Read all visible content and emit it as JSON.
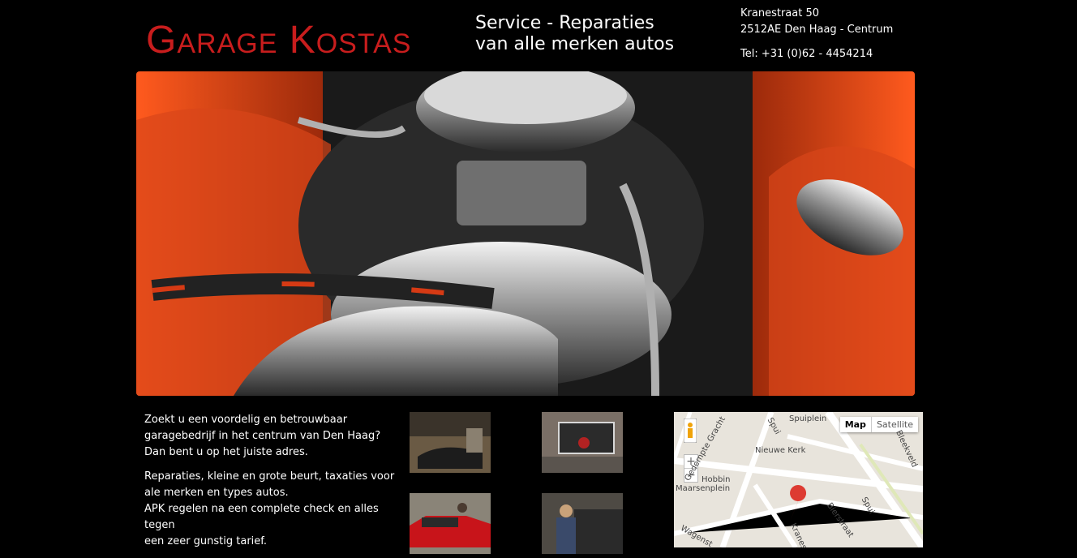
{
  "header": {
    "logo_text": "Garage Kostas",
    "tagline_line1": "Service - Reparaties",
    "tagline_line2": "van alle merken autos",
    "address_line1": "Kranestraat 50",
    "address_line2": "2512AE Den Haag - Centrum",
    "phone": "Tel: +31 (0)62 - 4454214"
  },
  "intro": {
    "p1_line1": "Zoekt u een voordelig en betrouwbaar",
    "p1_line2": "garagebedrijf in het centrum van Den Haag?",
    "p1_line3": "Dan bent u op het juiste adres.",
    "p2_line1": "Reparaties, kleine en grote beurt, taxaties voor",
    "p2_line2": "ale merken en types autos.",
    "p2_line3": "APK regelen na een complete check en alles tegen",
    "p2_line4": "een zeer gunstig tarief."
  },
  "map": {
    "btn_map": "Map",
    "btn_satellite": "Satellite",
    "zoom_in": "+",
    "zoom_out": "−",
    "labels": {
      "spuiplein": "Spuiplein",
      "spui1": "Spui",
      "nieuwe_kerk": "Nieuwe Kerk",
      "gracht": "Gedempte Gracht",
      "bleekveld": "Bleekveld",
      "hobbin": "Hobbin",
      "maarsenplein": "Maarsenplein",
      "spui2": "Spui",
      "bierstraat": "Bierstraat",
      "kranes": "Kranes",
      "wagens": "Wagenst"
    }
  },
  "colors": {
    "accent": "#c81d1d",
    "background": "#000000"
  }
}
